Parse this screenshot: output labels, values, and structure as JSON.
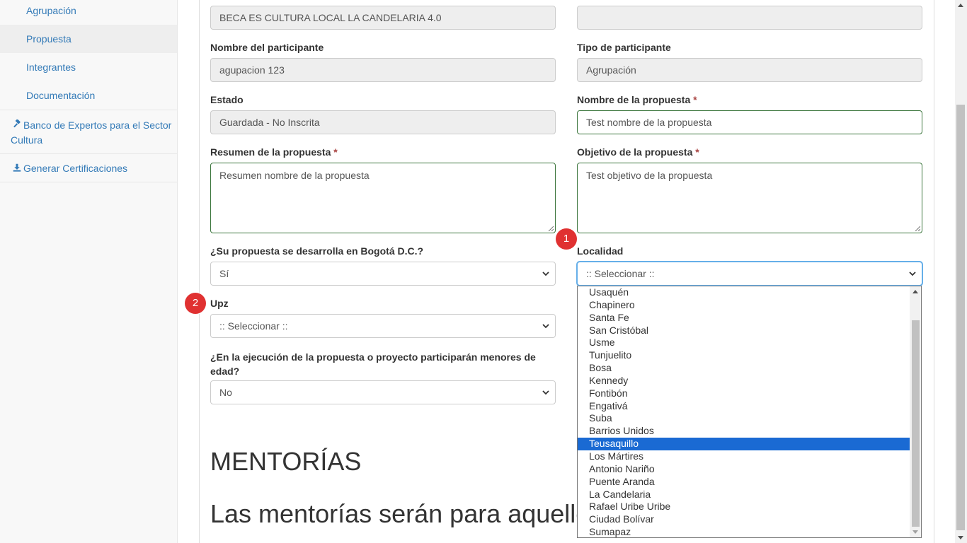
{
  "sidebar": {
    "sub_items": [
      {
        "label": "Agrupación"
      },
      {
        "label": "Propuesta"
      },
      {
        "label": "Integrantes"
      },
      {
        "label": "Documentación"
      }
    ],
    "banco_label": "Banco de Expertos para el Sector Cultura",
    "certificaciones_label": "Generar Certificaciones"
  },
  "form": {
    "convocatoria_value": "BECA ES CULTURA LOCAL LA CANDELARIA 4.0",
    "codigo_value": "",
    "nombre_participante_label": "Nombre del participante",
    "nombre_participante_value": "agupacion 123",
    "tipo_participante_label": "Tipo de participante",
    "tipo_participante_value": "Agrupación",
    "estado_label": "Estado",
    "estado_value": "Guardada - No Inscrita",
    "nombre_propuesta_label": "Nombre de la propuesta",
    "nombre_propuesta_value": "Test nombre de la propuesta",
    "resumen_label": "Resumen de la propuesta",
    "resumen_value": "Resumen nombre de la propuesta",
    "objetivo_label": "Objetivo de la propuesta",
    "objetivo_value": "Test objetivo de la propuesta",
    "bogota_label": "¿Su propuesta se desarrolla en Bogotá D.C.?",
    "bogota_value": "Sí",
    "localidad_label": "Localidad",
    "localidad_value": ":: Seleccionar ::",
    "upz_label": "Upz",
    "upz_value": ":: Seleccionar ::",
    "menores_label": "¿En la ejecución de la propuesta o proyecto participarán menores de edad?",
    "menores_value": "No",
    "required_mark": "*"
  },
  "badges": {
    "one": "1",
    "two": "2"
  },
  "mentorias": {
    "title": "MENTORÍAS",
    "text": "Las mentorías serán para aquellos seleccionados como ganadores"
  },
  "localidad_options": [
    "Usaquén",
    "Chapinero",
    "Santa Fe",
    "San Cristóbal",
    "Usme",
    "Tunjuelito",
    "Bosa",
    "Kennedy",
    "Fontibón",
    "Engativá",
    "Suba",
    "Barrios Unidos",
    "Teusaquillo",
    "Los Mártires",
    "Antonio Nariño",
    "Puente Aranda",
    "La Candelaria",
    "Rafael Uribe Uribe",
    "Ciudad Bolívar",
    "Sumapaz"
  ],
  "localidad_selected": "Teusaquillo",
  "colors": {
    "accent": "#337ab7",
    "selected": "#1a6ad3",
    "badge": "#e03131",
    "valid": "#3c763d"
  }
}
